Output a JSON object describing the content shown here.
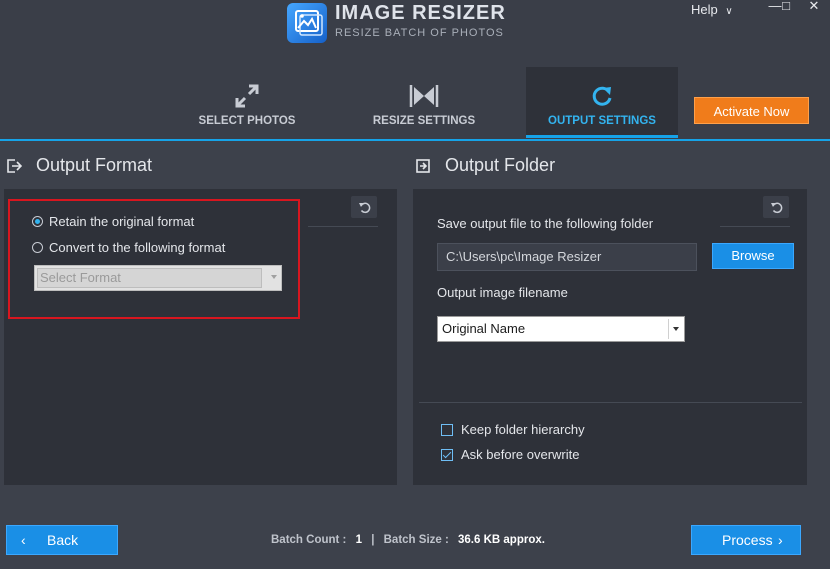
{
  "app": {
    "title": "IMAGE RESIZER",
    "subtitle": "RESIZE BATCH OF PHOTOS",
    "help_label": "Help"
  },
  "tabs": [
    {
      "label": "SELECT PHOTOS",
      "icon": "expand-arrows-icon",
      "active": false
    },
    {
      "label": "RESIZE SETTINGS",
      "icon": "resize-bowtie-icon",
      "active": false
    },
    {
      "label": "OUTPUT SETTINGS",
      "icon": "refresh-cycle-icon",
      "active": true
    }
  ],
  "activate_label": "Activate Now",
  "output_format": {
    "heading": "Output Format",
    "option_retain": "Retain the original format",
    "option_convert": "Convert to the following format",
    "selected_option": "retain",
    "format_placeholder": "Select Format"
  },
  "output_folder": {
    "heading": "Output Folder",
    "save_label": "Save output file to the following folder",
    "path": "C:\\Users\\pc\\Image Resizer",
    "browse_label": "Browse",
    "filename_label": "Output image filename",
    "filename_value": "Original Name",
    "keep_hierarchy_label": "Keep folder hierarchy",
    "keep_hierarchy_checked": false,
    "ask_overwrite_label": "Ask before overwrite",
    "ask_overwrite_checked": true
  },
  "footer": {
    "back_label": "Back",
    "batch_count_label": "Batch Count :",
    "batch_count_value": "1",
    "separator": "|",
    "batch_size_label": "Batch Size :",
    "batch_size_value": "36.6 KB approx.",
    "process_label": "Process"
  },
  "colors": {
    "accent_blue": "#1a8fe6",
    "activate_orange": "#f07c1b",
    "highlight_red": "#d8161f"
  }
}
